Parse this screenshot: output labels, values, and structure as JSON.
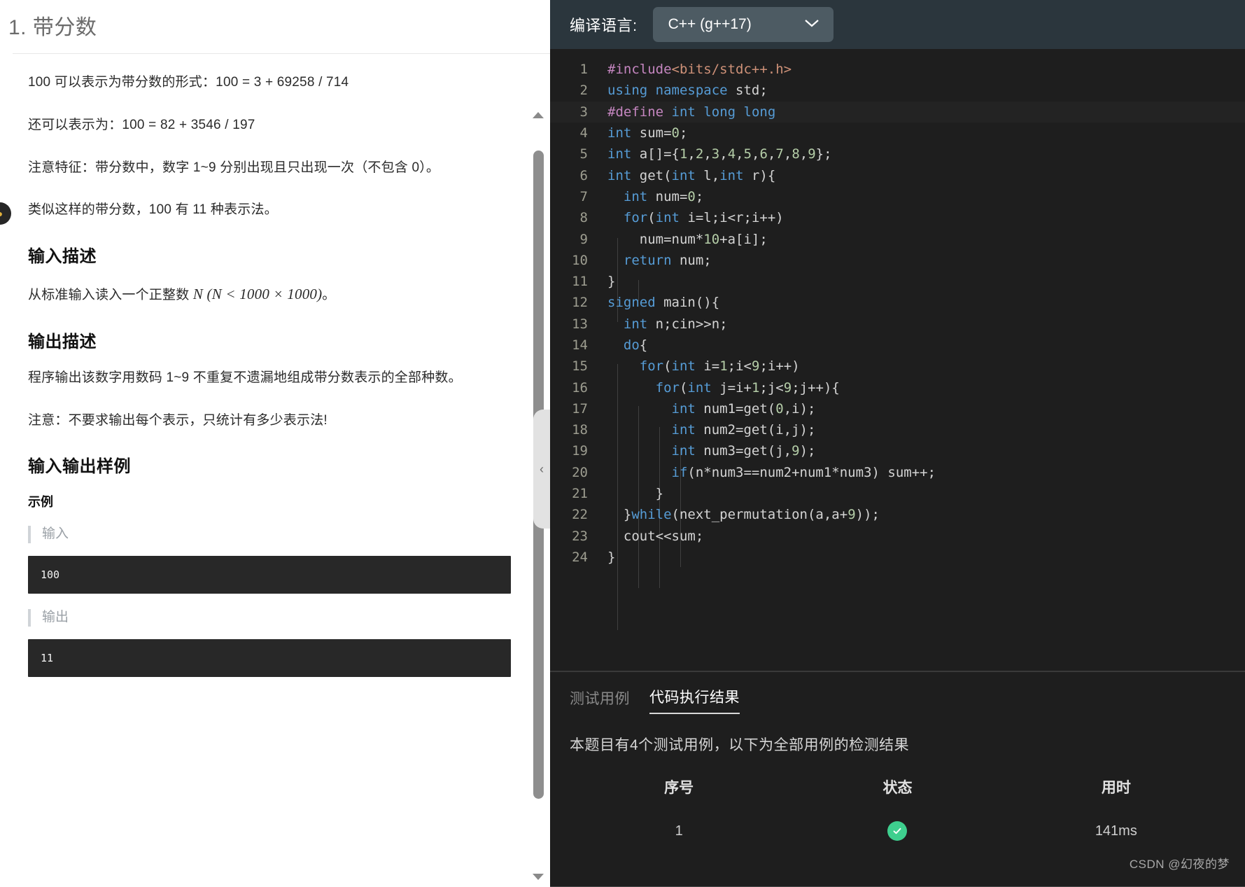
{
  "problem": {
    "title": "1. 带分数",
    "paragraphs": [
      "100 可以表示为带分数的形式：100 = 3 + 69258 / 714",
      "还可以表示为：100 = 82 + 3546 / 197",
      "注意特征：带分数中，数字 1~9 分别出现且只出现一次（不包含 0）。",
      "类似这样的带分数，100 有 11 种表示法。"
    ],
    "input_section_title": "输入描述",
    "input_desc_prefix": "从标准输入读入一个正整数 ",
    "input_desc_math": "N (N < 1000 × 1000)",
    "input_desc_suffix": "。",
    "output_section_title": "输出描述",
    "output_desc": "程序输出该数字用数码 1~9 不重复不遗漏地组成带分数表示的全部种数。",
    "output_note": "注意：不要求输出每个表示，只统计有多少表示法!",
    "sample_section_title": "输入输出样例",
    "sample_subtitle": "示例",
    "sample_input_label": "输入",
    "sample_input_value": "100",
    "sample_output_label": "输出",
    "sample_output_value": "11",
    "badge_icon": "coin-icon",
    "scrollbar": {
      "up_arrow": "triangle-up-icon",
      "down_arrow": "triangle-down-icon",
      "collapse_icon": "‹"
    }
  },
  "editor": {
    "language_label": "编译语言:",
    "language_value": "C++ (g++17)",
    "chevron": "⌄",
    "lines": [
      {
        "n": "1",
        "current": false,
        "segs": [
          {
            "t": "#include",
            "c": "pre"
          },
          {
            "t": "<bits/stdc++.h>",
            "c": "str"
          }
        ]
      },
      {
        "n": "2",
        "current": false,
        "segs": [
          {
            "t": "using",
            "c": "kw"
          },
          {
            "t": " ",
            "c": "plain"
          },
          {
            "t": "namespace",
            "c": "kw"
          },
          {
            "t": " std;",
            "c": "plain"
          }
        ]
      },
      {
        "n": "3",
        "current": true,
        "segs": [
          {
            "t": "#define",
            "c": "pre"
          },
          {
            "t": " ",
            "c": "plain"
          },
          {
            "t": "int",
            "c": "kw"
          },
          {
            "t": " ",
            "c": "plain"
          },
          {
            "t": "long",
            "c": "kw"
          },
          {
            "t": " ",
            "c": "plain"
          },
          {
            "t": "long",
            "c": "kw"
          }
        ]
      },
      {
        "n": "4",
        "current": false,
        "segs": [
          {
            "t": "int",
            "c": "kw"
          },
          {
            "t": " sum=",
            "c": "plain"
          },
          {
            "t": "0",
            "c": "num"
          },
          {
            "t": ";",
            "c": "plain"
          }
        ]
      },
      {
        "n": "5",
        "current": false,
        "segs": [
          {
            "t": "int",
            "c": "kw"
          },
          {
            "t": " a[]={",
            "c": "plain"
          },
          {
            "t": "1",
            "c": "num"
          },
          {
            "t": ",",
            "c": "plain"
          },
          {
            "t": "2",
            "c": "num"
          },
          {
            "t": ",",
            "c": "plain"
          },
          {
            "t": "3",
            "c": "num"
          },
          {
            "t": ",",
            "c": "plain"
          },
          {
            "t": "4",
            "c": "num"
          },
          {
            "t": ",",
            "c": "plain"
          },
          {
            "t": "5",
            "c": "num"
          },
          {
            "t": ",",
            "c": "plain"
          },
          {
            "t": "6",
            "c": "num"
          },
          {
            "t": ",",
            "c": "plain"
          },
          {
            "t": "7",
            "c": "num"
          },
          {
            "t": ",",
            "c": "plain"
          },
          {
            "t": "8",
            "c": "num"
          },
          {
            "t": ",",
            "c": "plain"
          },
          {
            "t": "9",
            "c": "num"
          },
          {
            "t": "};",
            "c": "plain"
          }
        ]
      },
      {
        "n": "6",
        "current": false,
        "segs": [
          {
            "t": "int",
            "c": "kw"
          },
          {
            "t": " get(",
            "c": "plain"
          },
          {
            "t": "int",
            "c": "kw"
          },
          {
            "t": " l,",
            "c": "plain"
          },
          {
            "t": "int",
            "c": "kw"
          },
          {
            "t": " r){",
            "c": "plain"
          }
        ]
      },
      {
        "n": "7",
        "current": false,
        "segs": [
          {
            "t": "  ",
            "c": "plain"
          },
          {
            "t": "int",
            "c": "kw"
          },
          {
            "t": " num=",
            "c": "plain"
          },
          {
            "t": "0",
            "c": "num"
          },
          {
            "t": ";",
            "c": "plain"
          }
        ]
      },
      {
        "n": "8",
        "current": false,
        "segs": [
          {
            "t": "  ",
            "c": "plain"
          },
          {
            "t": "for",
            "c": "kw"
          },
          {
            "t": "(",
            "c": "plain"
          },
          {
            "t": "int",
            "c": "kw"
          },
          {
            "t": " i=l;i<r;i++)",
            "c": "plain"
          }
        ]
      },
      {
        "n": "9",
        "current": false,
        "segs": [
          {
            "t": "    num=num*",
            "c": "plain"
          },
          {
            "t": "10",
            "c": "num"
          },
          {
            "t": "+a[i];",
            "c": "plain"
          }
        ]
      },
      {
        "n": "10",
        "current": false,
        "segs": [
          {
            "t": "  ",
            "c": "plain"
          },
          {
            "t": "return",
            "c": "kw"
          },
          {
            "t": " num;",
            "c": "plain"
          }
        ]
      },
      {
        "n": "11",
        "current": false,
        "segs": [
          {
            "t": "}",
            "c": "plain"
          }
        ]
      },
      {
        "n": "12",
        "current": false,
        "segs": [
          {
            "t": "signed",
            "c": "kw"
          },
          {
            "t": " main(){",
            "c": "plain"
          }
        ]
      },
      {
        "n": "13",
        "current": false,
        "segs": [
          {
            "t": "  ",
            "c": "plain"
          },
          {
            "t": "int",
            "c": "kw"
          },
          {
            "t": " n;cin>>n;",
            "c": "plain"
          }
        ]
      },
      {
        "n": "14",
        "current": false,
        "segs": [
          {
            "t": "  ",
            "c": "plain"
          },
          {
            "t": "do",
            "c": "kw"
          },
          {
            "t": "{",
            "c": "plain"
          }
        ]
      },
      {
        "n": "15",
        "current": false,
        "segs": [
          {
            "t": "    ",
            "c": "plain"
          },
          {
            "t": "for",
            "c": "kw"
          },
          {
            "t": "(",
            "c": "plain"
          },
          {
            "t": "int",
            "c": "kw"
          },
          {
            "t": " i=",
            "c": "plain"
          },
          {
            "t": "1",
            "c": "num"
          },
          {
            "t": ";i<",
            "c": "plain"
          },
          {
            "t": "9",
            "c": "num"
          },
          {
            "t": ";i++)",
            "c": "plain"
          }
        ]
      },
      {
        "n": "16",
        "current": false,
        "segs": [
          {
            "t": "      ",
            "c": "plain"
          },
          {
            "t": "for",
            "c": "kw"
          },
          {
            "t": "(",
            "c": "plain"
          },
          {
            "t": "int",
            "c": "kw"
          },
          {
            "t": " j=i+",
            "c": "plain"
          },
          {
            "t": "1",
            "c": "num"
          },
          {
            "t": ";j<",
            "c": "plain"
          },
          {
            "t": "9",
            "c": "num"
          },
          {
            "t": ";j++){",
            "c": "plain"
          }
        ]
      },
      {
        "n": "17",
        "current": false,
        "segs": [
          {
            "t": "        ",
            "c": "plain"
          },
          {
            "t": "int",
            "c": "kw"
          },
          {
            "t": " num1=get(",
            "c": "plain"
          },
          {
            "t": "0",
            "c": "num"
          },
          {
            "t": ",i);",
            "c": "plain"
          }
        ]
      },
      {
        "n": "18",
        "current": false,
        "segs": [
          {
            "t": "        ",
            "c": "plain"
          },
          {
            "t": "int",
            "c": "kw"
          },
          {
            "t": " num2=get(i,j);",
            "c": "plain"
          }
        ]
      },
      {
        "n": "19",
        "current": false,
        "segs": [
          {
            "t": "        ",
            "c": "plain"
          },
          {
            "t": "int",
            "c": "kw"
          },
          {
            "t": " num3=get(j,",
            "c": "plain"
          },
          {
            "t": "9",
            "c": "num"
          },
          {
            "t": ");",
            "c": "plain"
          }
        ]
      },
      {
        "n": "20",
        "current": false,
        "segs": [
          {
            "t": "        ",
            "c": "plain"
          },
          {
            "t": "if",
            "c": "kw"
          },
          {
            "t": "(n*num3==num2+num1*num3) sum++;",
            "c": "plain"
          }
        ]
      },
      {
        "n": "21",
        "current": false,
        "segs": [
          {
            "t": "      }",
            "c": "plain"
          }
        ]
      },
      {
        "n": "22",
        "current": false,
        "segs": [
          {
            "t": "  }",
            "c": "plain"
          },
          {
            "t": "while",
            "c": "kw"
          },
          {
            "t": "(next_permutation(a,a+",
            "c": "plain"
          },
          {
            "t": "9",
            "c": "num"
          },
          {
            "t": "));",
            "c": "plain"
          }
        ]
      },
      {
        "n": "23",
        "current": false,
        "segs": [
          {
            "t": "  cout<<sum;",
            "c": "plain"
          }
        ]
      },
      {
        "n": "24",
        "current": false,
        "segs": [
          {
            "t": "}",
            "c": "plain"
          }
        ]
      }
    ]
  },
  "results": {
    "tabs": [
      {
        "label": "测试用例",
        "active": false
      },
      {
        "label": "代码执行结果",
        "active": true
      }
    ],
    "description": "本题目有4个测试用例，以下为全部用例的检测结果",
    "columns": [
      "序号",
      "状态",
      "用时"
    ],
    "rows": [
      {
        "index": "1",
        "status_icon": "check-circle-icon",
        "time": "141ms"
      }
    ],
    "status_ok_color": "#3ecf8e",
    "watermark": "CSDN @幻夜的梦"
  }
}
